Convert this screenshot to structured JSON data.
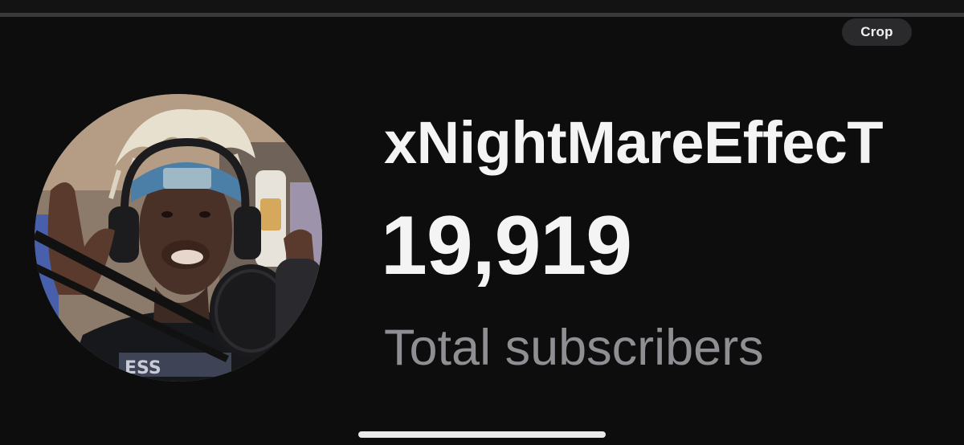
{
  "toolbar": {
    "crop_label": "Crop"
  },
  "profile": {
    "channel_name": "xNightMareEffecT",
    "subscriber_count": "19,919",
    "subscriber_label": "Total subscribers",
    "avatar_icon": "channel-avatar-photo"
  },
  "colors": {
    "background": "#0d0d0d",
    "primary_text": "#f4f4f4",
    "secondary_text": "#8e8e93",
    "pill_background": "#2a2a2c",
    "home_indicator": "#e9e9ea"
  }
}
